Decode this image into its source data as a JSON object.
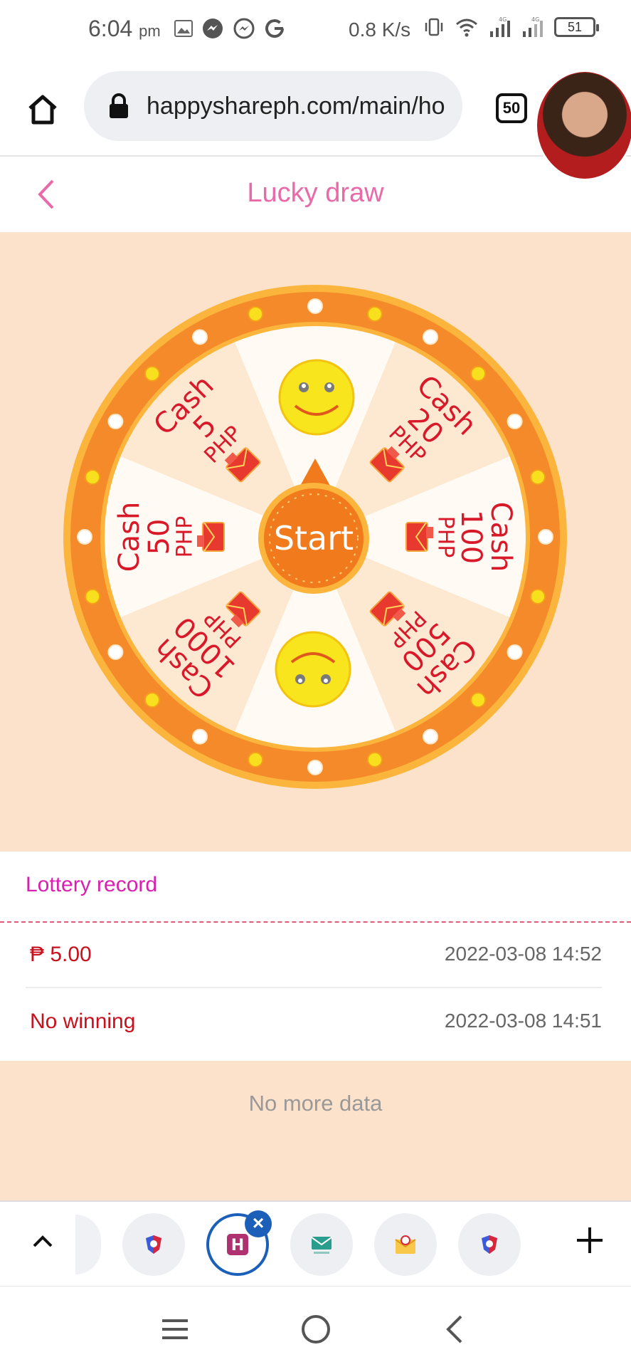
{
  "status_bar": {
    "time": "6:04",
    "ampm": "pm",
    "network_speed": "0.8 K/s",
    "battery": "51",
    "net_label_1": "4G",
    "net_label_2": "4G"
  },
  "browser": {
    "url": "happyshareph.com/main/ho",
    "tab_count": "50"
  },
  "header": {
    "title": "Lucky draw"
  },
  "wheel": {
    "start_label": "Start",
    "segments": [
      {
        "word": "Cash",
        "amount": "20",
        "unit": "PHP"
      },
      {
        "word": "Cash",
        "amount": "100",
        "unit": "PHP"
      },
      {
        "word": "Cash",
        "amount": "500",
        "unit": "PHP"
      },
      {
        "word": "Cash",
        "amount": "1000",
        "unit": "PHP"
      },
      {
        "word": "Cash",
        "amount": "50",
        "unit": "PHP"
      },
      {
        "word": "Cash",
        "amount": "5",
        "unit": "PHP"
      }
    ],
    "colors": {
      "ring": "#f48a2a",
      "ring_edge": "#fbb53c",
      "segment_light": "#fffaf3",
      "segment_tan": "#fde9d2",
      "text_red": "#d8192a",
      "hub": "#f07a1c"
    }
  },
  "records": {
    "title": "Lottery record",
    "items": [
      {
        "result": "₱ 5.00",
        "time": "2022-03-08 14:52"
      },
      {
        "result": "No winning",
        "time": "2022-03-08 14:51"
      }
    ],
    "footer": "No more data"
  },
  "tab_strip": {
    "active_tab_letter": "H",
    "chips": [
      "vpn-shield-icon",
      "active-tab-h",
      "tempmail-icon",
      "mail-at-icon",
      "vpn-shield-icon"
    ]
  }
}
